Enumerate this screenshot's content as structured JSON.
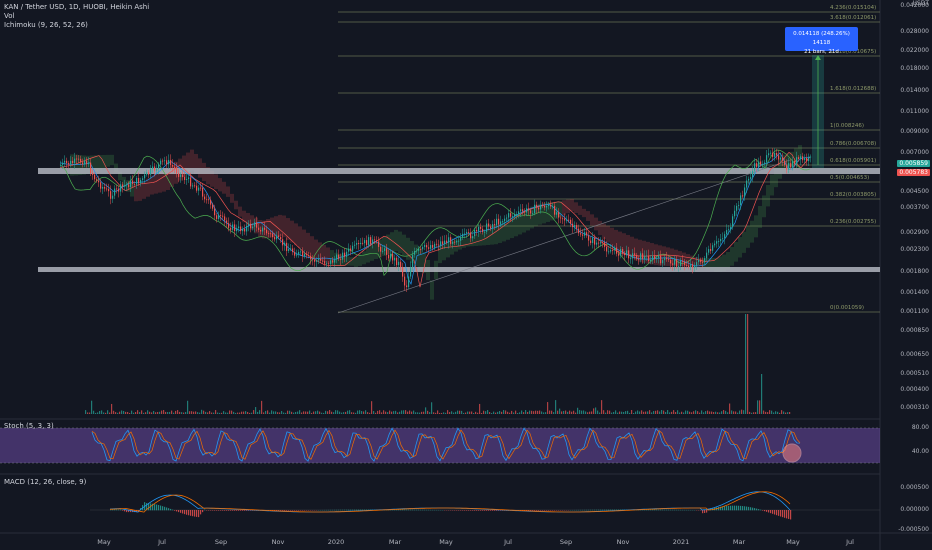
{
  "legend": {
    "main": "KAN / Tether USD, 1D, HUOBI, Heikin Ashi",
    "vol": "Vol",
    "ichimoku": "Ichimoku (9, 26, 52, 26)",
    "stoch": "Stoch (5, 3, 3)",
    "macd": "MACD (12, 26, close, 9)"
  },
  "currency": "USDT",
  "price_scale": [
    "0.042000",
    "0.028000",
    "0.022000",
    "0.018000",
    "0.014000",
    "0.011000",
    "0.009000",
    "0.007000",
    "0.004500",
    "0.003700",
    "0.002900",
    "0.002300",
    "0.001800",
    "0.001400",
    "0.001100",
    "0.000850",
    "0.000650",
    "0.000510",
    "0.000400",
    "0.000310"
  ],
  "price_tags": {
    "current": "0.005859",
    "secondary": "0.005783"
  },
  "fib_levels": [
    "4.236(0.015104)",
    "3.618(0.012061)",
    "2.618(0.010675)",
    "1.618(0.012688)",
    "1(0.008246)",
    "0.786(0.006708)",
    "0.618(0.005901)",
    "0.5(0.004653)",
    "0.382(0.003805)",
    "0.236(0.002755)",
    "0(0.001059)"
  ],
  "measure": {
    "line1": "0.014118 (248.26%) 14118",
    "line2": "21 bars, 21d"
  },
  "stoch_scale": [
    "80.00",
    "40.00"
  ],
  "macd_scale": [
    "0.000500",
    "0.000000",
    "-0.000500"
  ],
  "x_labels": [
    "May",
    "Jul",
    "Sep",
    "Nov",
    "2020",
    "Mar",
    "May",
    "Jul",
    "Sep",
    "Nov",
    "2021",
    "Mar",
    "May",
    "Jul"
  ],
  "colors": {
    "background": "#131722",
    "up": "#26a69a",
    "down": "#ef5350",
    "support": "#b2b5be",
    "fib": "#8f9a6a",
    "stoch_band": "#7e57c2",
    "measure": "#2962ff"
  }
}
